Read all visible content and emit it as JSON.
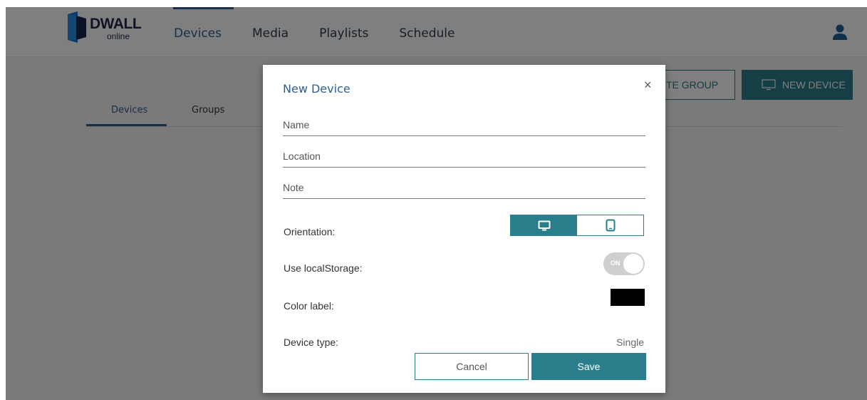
{
  "app": {
    "logo_text": "DWALL",
    "logo_sub": "online"
  },
  "nav": {
    "items": [
      {
        "label": "Devices"
      },
      {
        "label": "Media"
      },
      {
        "label": "Playlists"
      },
      {
        "label": "Schedule"
      }
    ]
  },
  "page": {
    "tabs": [
      {
        "label": "Devices"
      },
      {
        "label": "Groups"
      }
    ],
    "create_group_label": "TE GROUP",
    "new_device_label": "NEW DEVICE"
  },
  "modal": {
    "title": "New Device",
    "close_symbol": "×",
    "fields": {
      "name": {
        "placeholder": "Name",
        "value": ""
      },
      "location": {
        "placeholder": "Location",
        "value": ""
      },
      "note": {
        "placeholder": "Note",
        "value": ""
      }
    },
    "orientation_label": "Orientation:",
    "orientation_selected": "landscape",
    "local_storage_label": "Use localStorage:",
    "local_storage_state": "ON",
    "color_label": "Color label:",
    "color_value": "#000000",
    "device_type_label": "Device type:",
    "device_type_value": "Single",
    "cancel_label": "Cancel",
    "save_label": "Save"
  },
  "colors": {
    "accent": "#2a7d8a",
    "nav_active": "#2f5f8e"
  },
  "icons": {
    "logo": "dwall-logo-icon",
    "user": "user-icon",
    "monitor": "monitor-icon",
    "tablet": "tablet-icon",
    "close": "close-icon"
  }
}
